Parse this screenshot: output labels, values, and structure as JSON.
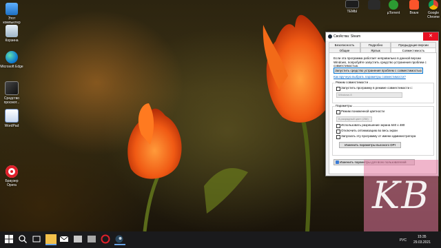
{
  "desktop": {
    "icons_left": [
      {
        "label": "Этот компьютер",
        "icon": "this-pc-icon"
      },
      {
        "label": "Корзина",
        "icon": "recycle-bin-icon"
      },
      {
        "label": "Microsoft Edge",
        "icon": "edge-icon"
      },
      {
        "label": "Средство просмот...",
        "icon": "viewer-icon"
      },
      {
        "label": "WordPad",
        "icon": "wordpad-icon"
      },
      {
        "label": "Браузер Opera",
        "icon": "opera-icon"
      }
    ],
    "icons_top_right": [
      {
        "label": "ТЕМЫ",
        "icon": "themes-icon"
      },
      {
        "label": "",
        "icon": "app-icon"
      },
      {
        "label": "µTorrent",
        "icon": "utorrent-icon"
      },
      {
        "label": "Brave",
        "icon": "brave-icon"
      },
      {
        "label": "Google Chrome",
        "icon": "chrome-icon"
      }
    ]
  },
  "dialog": {
    "title": "Свойства: Steam",
    "close_glyph": "✕",
    "tabs_row1": [
      "Безопасность",
      "Подробно",
      "Предыдущие версии"
    ],
    "tabs_row2": [
      "Общие",
      "Ярлык",
      "Совместимость"
    ],
    "active_tab": "Совместимость",
    "intro_text": "Если эта программа работает неправильно в данной версии Windows, попробуйте запустить средство устранения проблем с совместимостью.",
    "troubleshoot_button": "Запустить средство устранения проблем с совместимостью",
    "manual_link": "Как вручную выбрать параметры совместимости?",
    "compat_group_label": "Режим совместимости",
    "compat_checkbox": "Запустить программу в режиме совместимости с:",
    "compat_combo_value": "Windows 8",
    "params_group_label": "Параметры",
    "reduced_color_checkbox": "Режим пониженной цветности",
    "reduced_color_combo": "8-разрядный цвет (256)",
    "resolution_checkbox": "Использовать разрешение экрана 640 х 480",
    "fullscreen_opt_checkbox": "Отключить оптимизацию во весь экран",
    "admin_checkbox": "Запускать эту программу от имени администратора",
    "dpi_button": "Изменить параметры высокого DPI",
    "all_users_button": "Изменить параметры для всех пользователей"
  },
  "watermark": {
    "text": "KB",
    "color": "#e478a0"
  },
  "taskbar": {
    "tray_lang": "РУС",
    "time": "15:35",
    "date": "29.03.2021"
  },
  "colors": {
    "close_red": "#e81123",
    "accent_blue": "#0078d7",
    "taskbar_bg": "#1a1a1c"
  }
}
